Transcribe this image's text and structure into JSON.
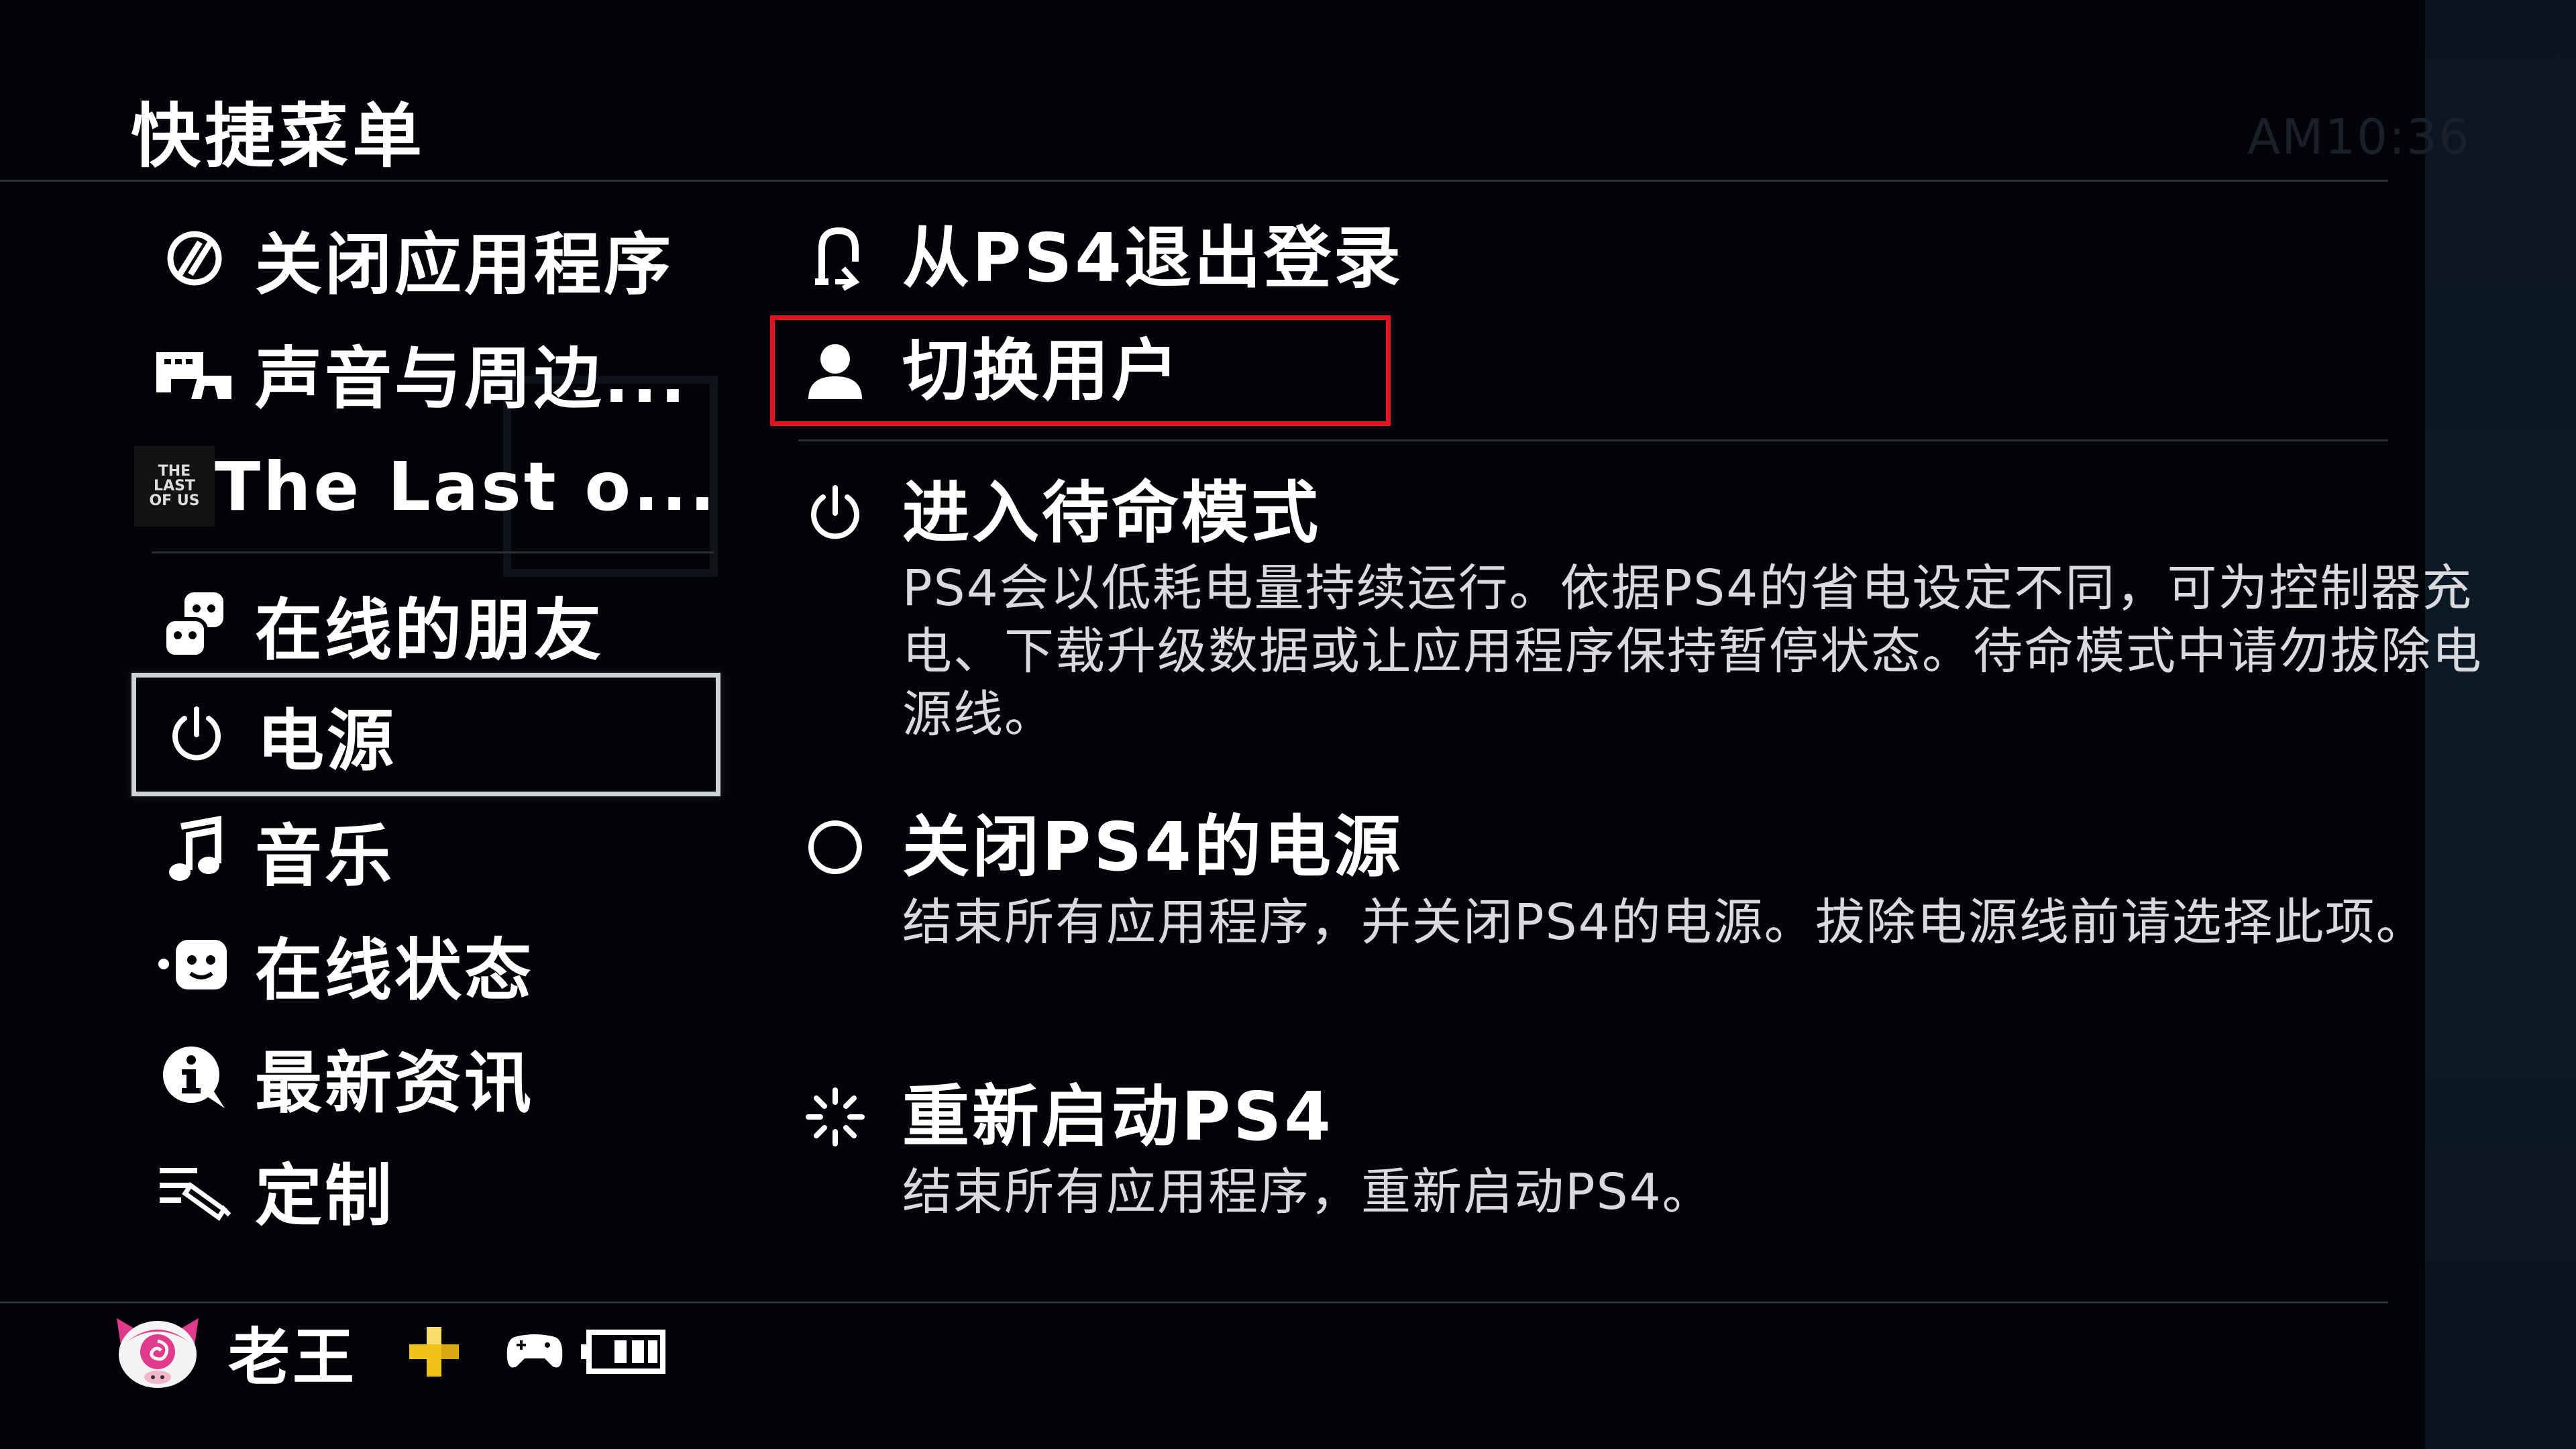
{
  "header": {
    "title": "快捷菜单",
    "clock": "AM10:36"
  },
  "menu": {
    "items": [
      {
        "id": "close-app",
        "icon": "close-app-icon",
        "label": "关闭应用程序"
      },
      {
        "id": "sound",
        "icon": "sound-devices-icon",
        "label": "声音与周边..."
      },
      {
        "id": "game",
        "icon": "game-thumbnail",
        "label": "The Last o...",
        "thumb_text": [
          "THE",
          "LAST",
          "OF US"
        ]
      },
      {
        "id": "friends",
        "icon": "friends-icon",
        "label": "在线的朋友"
      },
      {
        "id": "power",
        "icon": "power-icon",
        "label": "电源",
        "selected": true
      },
      {
        "id": "music",
        "icon": "music-note-icon",
        "label": "音乐"
      },
      {
        "id": "status",
        "icon": "online-status-icon",
        "label": "在线状态"
      },
      {
        "id": "news",
        "icon": "info-icon",
        "label": "最新资讯"
      },
      {
        "id": "customize",
        "icon": "customize-icon",
        "label": "定制"
      }
    ]
  },
  "power_menu": {
    "logout": {
      "icon": "logout-icon",
      "label": "从PS4退出登录"
    },
    "switch_user": {
      "icon": "user-icon",
      "label": "切换用户",
      "highlight_color": "#e0141e"
    },
    "rest_mode": {
      "icon": "rest-mode-icon",
      "label": "进入待命模式",
      "desc": "PS4会以低耗电量持续运行。依据PS4的省电设定不同，可为控制器充电、下载升级数据或让应用程序保持暂停状态。待命模式中请勿拔除电源线。"
    },
    "turn_off": {
      "icon": "circle-icon",
      "label": "关闭PS4的电源",
      "desc": "结束所有应用程序，并关闭PS4的电源。拔除电源线前请选择此项。"
    },
    "restart": {
      "icon": "restart-icon",
      "label": "重新启动PS4",
      "desc": "结束所有应用程序，重新启动PS4。"
    }
  },
  "footer": {
    "username": "老王",
    "icons": [
      "avatar-icon",
      "ps-plus-icon",
      "controller-icon",
      "battery-icon"
    ],
    "ps_plus_color": "#f2c21b"
  }
}
